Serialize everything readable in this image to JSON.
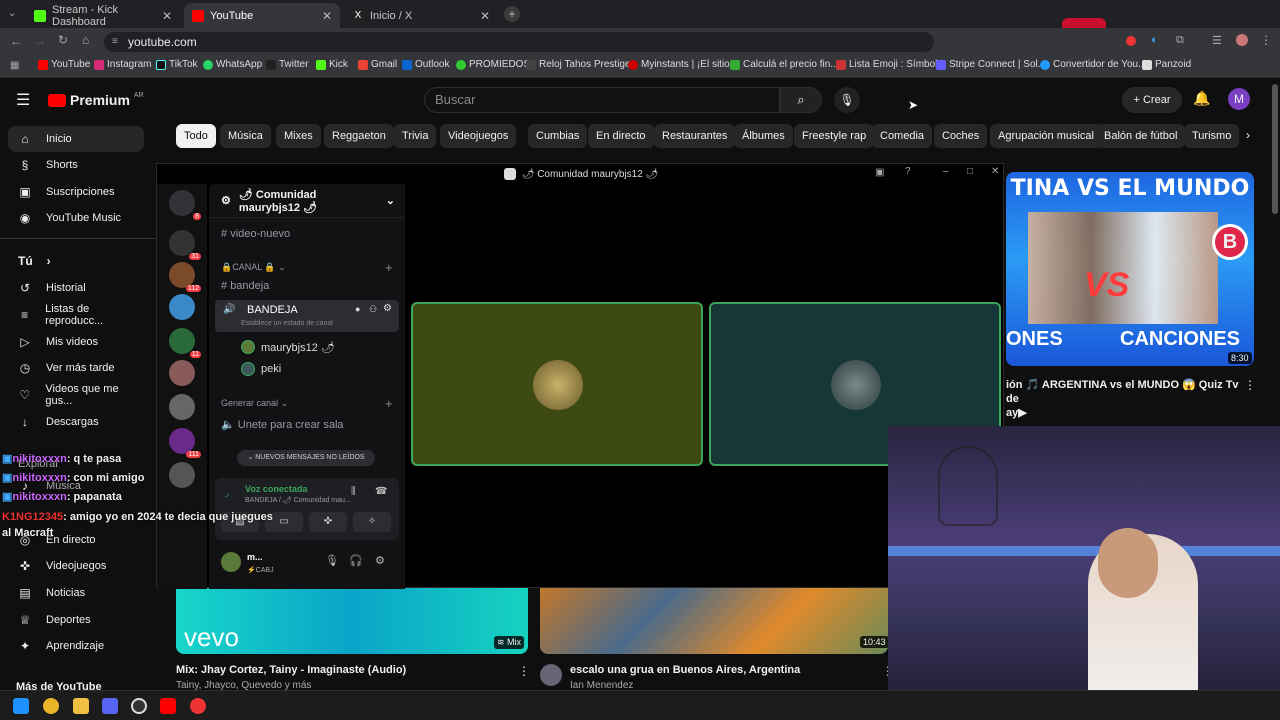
{
  "browser": {
    "tabs": [
      {
        "label": "Stream - Kick Dashboard",
        "color": "#53fc18"
      },
      {
        "label": "YouTube",
        "color": "#ff0000"
      },
      {
        "label": "Inicio / X",
        "color": "#ffffff"
      }
    ],
    "url": "youtube.com",
    "bookmarks": [
      "YouTube",
      "Instagram",
      "TikTok",
      "WhatsApp",
      "Twitter",
      "Kick",
      "Gmail",
      "Outlook",
      "PROMIEDOS",
      "Reloj Tahos Prestige...",
      "Myinstants | ¡El sitio...",
      "Calculá el precio fin...",
      "Lista Emoji : Símbol...",
      "Stripe Connect | Sol...",
      "Convertidor de You...",
      "Panzoid"
    ]
  },
  "youtube": {
    "logo": "Premium",
    "logo_region": "AR",
    "search_placeholder": "Buscar",
    "create_label": "Crear",
    "avatar_letter": "M",
    "chips": [
      "Todo",
      "Música",
      "Mixes",
      "Reggaeton",
      "Trivia",
      "Videojuegos",
      "Cumbias",
      "En directo",
      "Restaurantes",
      "Álbumes",
      "Freestyle rap",
      "Comedia",
      "Coches",
      "Agrupación musical",
      "Balón de fútbol",
      "Turismo"
    ],
    "sidebar": {
      "main": [
        {
          "label": "Inicio",
          "icon": "home-icon"
        },
        {
          "label": "Shorts",
          "icon": "shorts-icon"
        },
        {
          "label": "Suscripciones",
          "icon": "subscriptions-icon"
        },
        {
          "label": "YouTube Music",
          "icon": "music-icon"
        }
      ],
      "you_header": "Tú",
      "you": [
        {
          "label": "Historial",
          "icon": "history-icon"
        },
        {
          "label": "Listas de reproducc...",
          "icon": "playlist-icon"
        },
        {
          "label": "Mis videos",
          "icon": "video-icon"
        },
        {
          "label": "Ver más tarde",
          "icon": "clock-icon"
        },
        {
          "label": "Videos que me gus...",
          "icon": "like-icon"
        },
        {
          "label": "Descargas",
          "icon": "download-icon"
        }
      ],
      "explore_header": "Explorar",
      "explore": [
        {
          "label": "Música",
          "icon": "music-note-icon"
        },
        {
          "label": "En directo",
          "icon": "live-icon"
        },
        {
          "label": "Videojuegos",
          "icon": "gamepad-icon"
        },
        {
          "label": "Noticias",
          "icon": "news-icon"
        },
        {
          "label": "Deportes",
          "icon": "trophy-icon"
        },
        {
          "label": "Aprendizaje",
          "icon": "bulb-icon"
        }
      ],
      "more_header": "Más de YouTube"
    },
    "videos": [
      {
        "title": "ión 🎵 ARGENTINA vs el MUNDO 😱 Quiz Tv de",
        "title2": "ay▶",
        "duration": "8:30",
        "thumb_text1": "TINA VS EL MUNDO",
        "thumb_text2": "ONES",
        "thumb_text3": "CANCIONES",
        "thumb_badge": "B"
      },
      {
        "title": "Mix: Jhay Cortez, Tainy - Imaginaste (Audio)",
        "channel": "Tainy, Jhayco, Quevedo y más",
        "duration": "Mix",
        "thumb_text": "vevo"
      },
      {
        "title": "escalo una grua en Buenos Aires, Argentina",
        "channel": "Ian Menendez",
        "duration": "10:43"
      }
    ]
  },
  "discord": {
    "window_title": "🌶 Comunidad maurybjs12 🌶",
    "server_name": "🌶 Comunidad maurybjs12 🌶",
    "server_badges": [
      "8",
      "31",
      "112",
      "",
      "11",
      "",
      "",
      "111",
      ""
    ],
    "channels": {
      "top_channel": "video-nuevo",
      "category": "🔒CANAL 🔒",
      "text_channel": "bandeja",
      "voice_channel": "BANDEJA",
      "voice_status": "Establece un estado de canal",
      "members": [
        "maurybjs12 🌶",
        "peki"
      ],
      "generate_category": "Generar canal",
      "create_room": "Unete para crear sala",
      "unread_pill": "NUEVOS MENSAJES NO LEÍDOS"
    },
    "voice": {
      "status": "Voz conectada",
      "location": "BANDEJA / 🌶 Comunidad mau...",
      "user": "m...",
      "user_status": "⚡CABJ"
    }
  },
  "chat_overlay": [
    {
      "user": "nikitoxxxn",
      "msg": ": q te pasa"
    },
    {
      "user": "nikitoxxxn",
      "msg": ": con mi amigo"
    },
    {
      "user": "nikitoxxxn",
      "msg": ": papanata"
    },
    {
      "user": "K1NG12345",
      "msg": ": amigo yo en 2024 te decia que juegues al Macraft"
    }
  ],
  "taskbar_icons": [
    "windows-icon",
    "chrome-icon",
    "folder-icon",
    "discord-icon",
    "obs-icon",
    "youtube-icon",
    "app-icon"
  ]
}
